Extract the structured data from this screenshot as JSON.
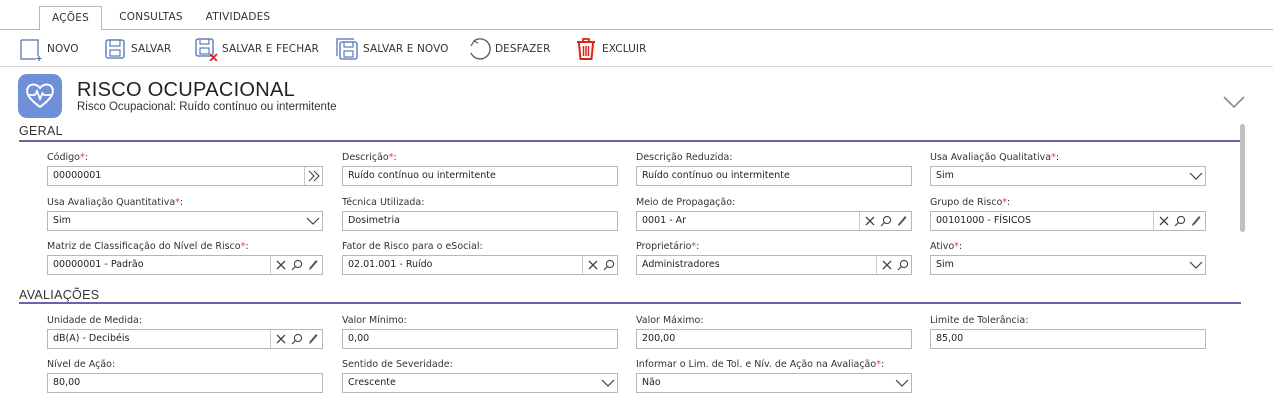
{
  "tabs": [
    {
      "label": "AÇÕES",
      "active": true
    },
    {
      "label": "CONSULTAS",
      "active": false
    },
    {
      "label": "ATIVIDADES",
      "active": false
    }
  ],
  "toolbar": {
    "novo": "NOVO",
    "salvar": "SALVAR",
    "salvar_fechar": "SALVAR E FECHAR",
    "salvar_novo": "SALVAR E NOVO",
    "desfazer": "DESFAZER",
    "excluir": "EXCLUIR"
  },
  "header": {
    "title": "RISCO OCUPACIONAL",
    "subtitle": "Risco Ocupacional: Ruído contínuo ou intermitente"
  },
  "sections": {
    "geral": "GERAL",
    "avaliacoes": "AVALIAÇÕES"
  },
  "fields": {
    "codigo": {
      "label": "Código",
      "value": "00000001",
      "required": true
    },
    "descricao": {
      "label": "Descrição",
      "value": "Ruído contínuo ou intermitente",
      "required": true
    },
    "descricao_reduzida": {
      "label": "Descrição Reduzida:",
      "value": "Ruído contínuo ou intermitente",
      "required": false
    },
    "usa_qualitativa": {
      "label": "Usa Avaliação Qualitativa",
      "value": "Sim",
      "required": true
    },
    "usa_quantitativa": {
      "label": "Usa Avaliação Quantitativa",
      "value": "Sim",
      "required": true
    },
    "tecnica": {
      "label": "Técnica Utilizada:",
      "value": "Dosimetria",
      "required": false
    },
    "meio_propagacao": {
      "label": "Meio de Propagação:",
      "value": "0001 - Ar",
      "required": false
    },
    "grupo_risco": {
      "label": "Grupo de Risco",
      "value": "00101000 - FÍSICOS",
      "required": true
    },
    "matriz": {
      "label": "Matriz de Classificação do Nível de Risco",
      "value": "00000001 - Padrão",
      "required": true
    },
    "fator_esocial": {
      "label": "Fator de Risco para o eSocial:",
      "value": "02.01.001 - Ruído",
      "required": false
    },
    "proprietario": {
      "label": "Proprietário",
      "value": "Administradores",
      "required": true
    },
    "ativo": {
      "label": "Ativo",
      "value": "Sim",
      "required": true
    },
    "unidade": {
      "label": "Unidade de Medida:",
      "value": "dB(A) - Decibéis",
      "required": false
    },
    "valor_min": {
      "label": "Valor Mínimo:",
      "value": "0,00",
      "required": false
    },
    "valor_max": {
      "label": "Valor Máximo:",
      "value": "200,00",
      "required": false
    },
    "limite": {
      "label": "Limite de Tolerância:",
      "value": "85,00",
      "required": false
    },
    "nivel_acao": {
      "label": "Nível de Ação:",
      "value": "80,00",
      "required": false
    },
    "sentido": {
      "label": "Sentido de Severidade:",
      "value": "Crescente",
      "required": false
    },
    "informar_lim": {
      "label": "Informar o Lim. de Tol. e Nív. de Ação na Avaliação",
      "value": "Não",
      "required": true
    }
  },
  "required_marker": "*",
  "label_suffix": ":",
  "colors": {
    "accent": "#6c63ad",
    "app_icon": "#6f8fd9",
    "required": "#e23b3b",
    "delete": "#d9261c",
    "icon_blue": "#4a6fb3"
  }
}
